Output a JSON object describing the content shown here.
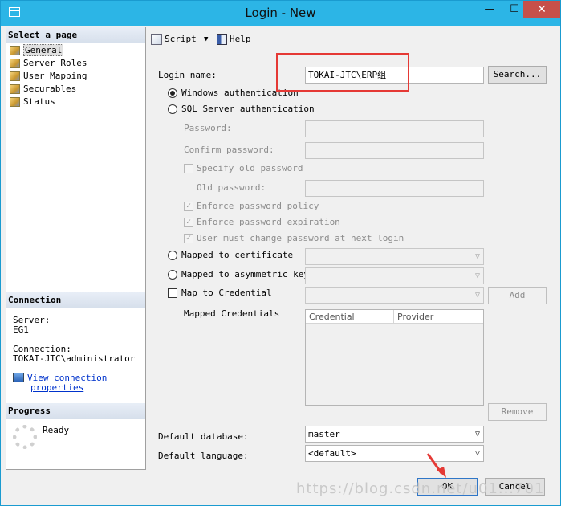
{
  "window": {
    "title": "Login - New",
    "min": "—",
    "max": "☐",
    "close": "✕"
  },
  "left": {
    "select_page_header": "Select a page",
    "pages": [
      {
        "label": "General"
      },
      {
        "label": "Server Roles"
      },
      {
        "label": "User Mapping"
      },
      {
        "label": "Securables"
      },
      {
        "label": "Status"
      }
    ],
    "connection_header": "Connection",
    "server_label": "Server:",
    "server_value": "EG1",
    "connection_label": "Connection:",
    "connection_value": "TOKAI-JTC\\administrator",
    "view_link_line1": "View connection",
    "view_link_line2": "properties",
    "progress_header": "Progress",
    "progress_status": "Ready"
  },
  "toolbar": {
    "script": "Script",
    "dropdown": "▼",
    "help": "Help"
  },
  "form": {
    "login_name_label": "Login name:",
    "login_name_value": "TOKAI-JTC\\ERP组",
    "search_button": "Search...",
    "windows_auth": "Windows authentication",
    "sql_auth": "SQL Server authentication",
    "password": "Password:",
    "confirm_password": "Confirm password:",
    "specify_old": "Specify old password",
    "old_password": "Old password:",
    "enforce_policy": "Enforce password policy",
    "enforce_expiration": "Enforce password expiration",
    "must_change": "User must change password at next login",
    "mapped_cert": "Mapped to certificate",
    "mapped_asym": "Mapped to asymmetric key",
    "map_cred": "Map to Credential",
    "add_button": "Add",
    "mapped_creds_label": "Mapped Credentials",
    "grid_col_credential": "Credential",
    "grid_col_provider": "Provider",
    "remove_button": "Remove",
    "default_db_label": "Default database:",
    "default_db_value": "master",
    "default_lang_label": "Default language:",
    "default_lang_value": "<default>"
  },
  "footer": {
    "ok": "OK",
    "cancel": "Cancel",
    "watermark": "https://blog.csdn.net/u01...701"
  },
  "colors": {
    "titlebar": "#2cb5e6",
    "close": "#c7504a",
    "highlight": "#e53935",
    "link": "#0033cc"
  }
}
